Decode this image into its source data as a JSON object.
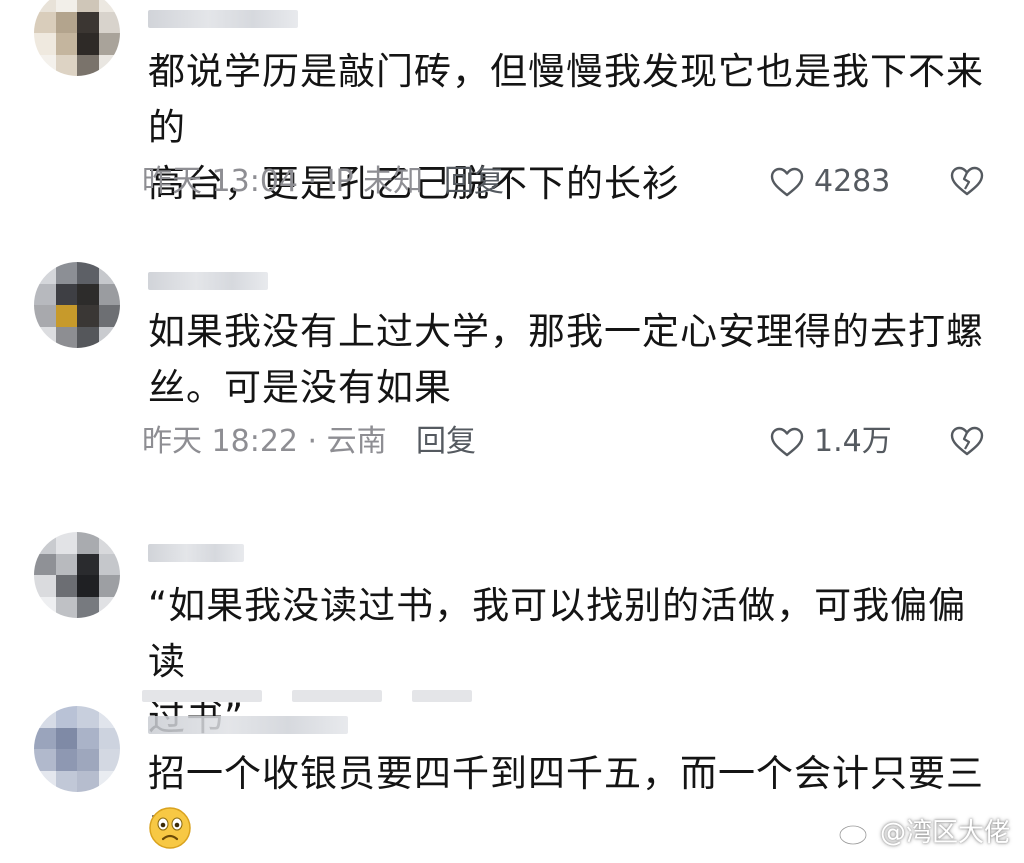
{
  "comments": [
    {
      "text": "都说学历是敲门砖，但慢慢我发现它也是我下不来的\n高台，更是孔乙己脱不下的长衫",
      "meta": "昨天 13:04 · IP 未知",
      "reply_label": "回复",
      "likes": "4283"
    },
    {
      "text": "如果我没有上过大学，那我一定心安理得的去打螺\n丝。可是没有如果",
      "meta": "昨天 18:22 · 云南",
      "reply_label": "回复",
      "likes": "1.4万"
    },
    {
      "text": "“如果我没读过书，我可以找别的活做，可我偏偏读\n过书”"
    },
    {
      "text": "招一个收银员要四千到四千五，而一个会计只要三千",
      "emoji": "🙁"
    }
  ],
  "watermark": "@湾区大佬",
  "colors": {
    "text": "#141414",
    "meta": "#8e8e93",
    "icon": "#555a60"
  },
  "icons": {
    "like": "heart-outline-icon",
    "dislike": "broken-heart-icon",
    "weibo": "weibo-logo-icon"
  }
}
